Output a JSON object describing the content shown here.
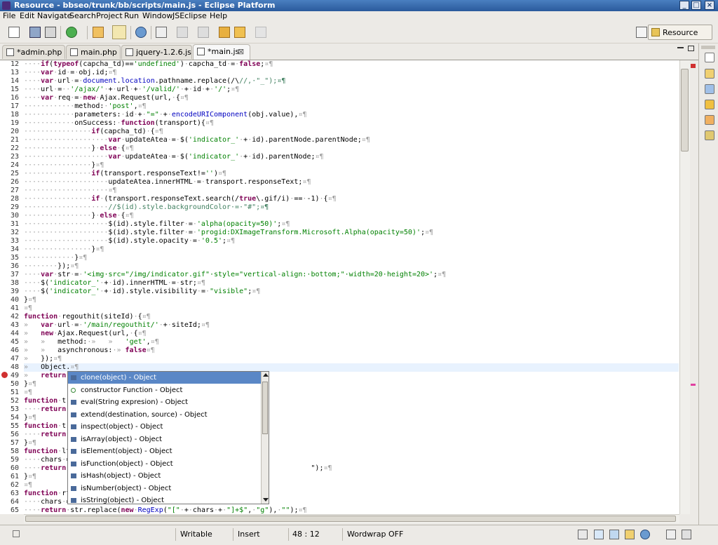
{
  "window": {
    "title": "Resource - bbseo/trunk/bb/scripts/main.js - Eclipse Platform",
    "buttons": [
      "_",
      "□",
      "×"
    ]
  },
  "menu": [
    "File",
    "Edit",
    "Navigate",
    "Search",
    "Project",
    "Run",
    "Window",
    "JSEclipse",
    "Help"
  ],
  "toolbar": {
    "perspective_label": "Resource"
  },
  "tabs": [
    {
      "label": "*admin.php"
    },
    {
      "label": "main.php"
    },
    {
      "label": "jquery-1.2.6.js"
    },
    {
      "label": "*main.js",
      "active": true,
      "close": "⊠"
    }
  ],
  "editor": {
    "lines": [
      {
        "n": "12",
        "t": "····if(typeof(capcha_td)=='undefined')·capcha_td·=·false;¤¶"
      },
      {
        "n": "13",
        "t": "····var·id·=·obj.id;¤¶"
      },
      {
        "n": "14",
        "t": "····var·url·=·document.location.pathname.replace(/\\//,·\"_\");¤¶"
      },
      {
        "n": "15",
        "t": "····url·=··'/ajax/'·+·url·+·'/valid/'·+·id·+·'/';¤¶"
      },
      {
        "n": "16",
        "t": "····var·req·=·new·Ajax.Request(url,·{¤¶"
      },
      {
        "n": "17",
        "t": "············method:·'post',¤¶"
      },
      {
        "n": "18",
        "t": "············parameters:·id·+·\"=\"·+·encodeURIComponent(obj.value),¤¶"
      },
      {
        "n": "19",
        "t": "············onSuccess:·function(transport){¤¶"
      },
      {
        "n": "20",
        "t": "················if(capcha_td)·{¤¶"
      },
      {
        "n": "21",
        "t": "····················var·updateAtea·=·$('indicator_'·+·id).parentNode.parentNode;¤¶"
      },
      {
        "n": "22",
        "t": "················}·else·{¤¶"
      },
      {
        "n": "23",
        "t": "····················var·updateAtea·=·$('indicator_'·+·id).parentNode;¤¶"
      },
      {
        "n": "24",
        "t": "················}¤¶"
      },
      {
        "n": "25",
        "t": "················if(transport.responseText!='')¤¶"
      },
      {
        "n": "26",
        "t": "····················updateAtea.innerHTML·=·transport.responseText;¤¶"
      },
      {
        "n": "27",
        "t": "····················¤¶"
      },
      {
        "n": "28",
        "t": "················if·(transport.responseText.search(/true\\.gif/i)·==·-1)·{¤¶"
      },
      {
        "n": "29",
        "t": "····················//$(id).style.backgroundColor·=·\"#\";¤¶"
      },
      {
        "n": "30",
        "t": "················}·else·{¤¶"
      },
      {
        "n": "31",
        "t": "····················$(id).style.filter·=·'alpha(opacity=50)';¤¶"
      },
      {
        "n": "32",
        "t": "····················$(id).style.filter·=·'progid:DXImageTransform.Microsoft.Alpha(opacity=50)';¤¶"
      },
      {
        "n": "33",
        "t": "····················$(id).style.opacity·=·'0.5';¤¶"
      },
      {
        "n": "34",
        "t": "················}¤¶"
      },
      {
        "n": "35",
        "t": "············}¤¶"
      },
      {
        "n": "36",
        "t": "········});¤¶"
      },
      {
        "n": "37",
        "t": "····var·str·=·'<img·src=\"/img/indicator.gif\"·style=\"vertical-align:·bottom;\"·width=20·height=20>';¤¶"
      },
      {
        "n": "38",
        "t": "····$('indicator_'·+·id).innerHTML·=·str;¤¶"
      },
      {
        "n": "39",
        "t": "····$('indicator_'·+·id).style.visibility·=·\"visible\";¤¶"
      },
      {
        "n": "40",
        "t": "}¤¶"
      },
      {
        "n": "41",
        "t": "¤¶"
      },
      {
        "n": "42",
        "t": "function·regouthit(siteId)·{¤¶"
      },
      {
        "n": "43",
        "t": "»   var·url·=·'/main/regouthit/'·+·siteId;¤¶"
      },
      {
        "n": "44",
        "t": "»   new·Ajax.Request(url,·{¤¶"
      },
      {
        "n": "45",
        "t": "»   »   method:·»   »   'get',¤¶"
      },
      {
        "n": "46",
        "t": "»   »   asynchronous:·» false¤¶"
      },
      {
        "n": "47",
        "t": "»   });¤¶"
      },
      {
        "n": "48",
        "t": "»   Object.¤¶"
      },
      {
        "n": "49",
        "t": "»   return"
      },
      {
        "n": "50",
        "t": "}¤¶"
      },
      {
        "n": "51",
        "t": "¤¶"
      },
      {
        "n": "52",
        "t": "function·tr"
      },
      {
        "n": "53",
        "t": "····return"
      },
      {
        "n": "54",
        "t": "}¤¶"
      },
      {
        "n": "55",
        "t": "function·tr"
      },
      {
        "n": "56",
        "t": "····return"
      },
      {
        "n": "57",
        "t": "}¤¶"
      },
      {
        "n": "58",
        "t": "function·lt"
      },
      {
        "n": "59",
        "t": "····chars·="
      },
      {
        "n": "60",
        "t": "····return                                                          \");¤¶"
      },
      {
        "n": "61",
        "t": "}¤¶"
      },
      {
        "n": "62",
        "t": "¤¶"
      },
      {
        "n": "63",
        "t": "function·rt"
      },
      {
        "n": "64",
        "t": "····chars·="
      },
      {
        "n": "65",
        "t": "····return·str.replace(new·RegExp(\"[\"·+·chars·+·\"]+$\",·\"g\"),·\"\");¤¶"
      }
    ]
  },
  "assist": {
    "items": [
      {
        "label": "clone(object) - Object",
        "selected": true
      },
      {
        "label": "constructor Function - Object"
      },
      {
        "label": "eval(String expresion) - Object"
      },
      {
        "label": "extend(destination, source) - Object"
      },
      {
        "label": "inspect(object) - Object"
      },
      {
        "label": "isArray(object) - Object"
      },
      {
        "label": "isElement(object) - Object"
      },
      {
        "label": "isFunction(object) - Object"
      },
      {
        "label": "isHash(object) - Object"
      },
      {
        "label": "isNumber(object) - Object"
      },
      {
        "label": "isString(object) - Object"
      }
    ]
  },
  "status": {
    "writable": "Writable",
    "insert": "Insert",
    "position": "48 : 12",
    "wordwrap": "Wordwrap OFF"
  },
  "colors": {
    "accent": "#5a87c6",
    "title_bar": "#2a5a9c",
    "error_marker": "#d03030"
  }
}
